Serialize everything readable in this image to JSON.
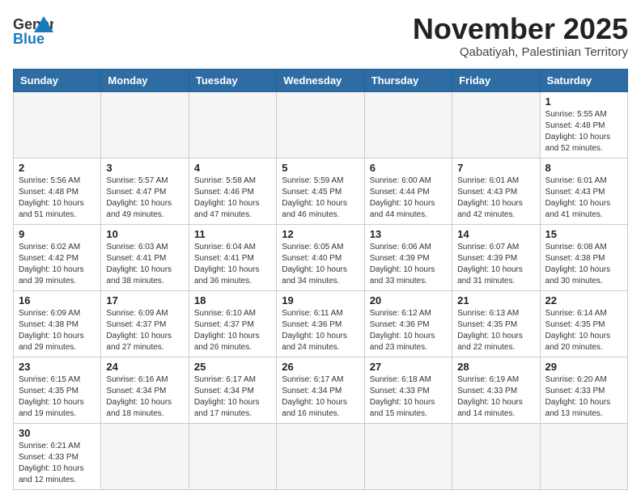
{
  "header": {
    "logo_general": "General",
    "logo_blue": "Blue",
    "title": "November 2025",
    "subtitle": "Qabatiyah, Palestinian Territory"
  },
  "weekdays": [
    "Sunday",
    "Monday",
    "Tuesday",
    "Wednesday",
    "Thursday",
    "Friday",
    "Saturday"
  ],
  "days": [
    {
      "date": "",
      "info": ""
    },
    {
      "date": "",
      "info": ""
    },
    {
      "date": "",
      "info": ""
    },
    {
      "date": "",
      "info": ""
    },
    {
      "date": "",
      "info": ""
    },
    {
      "date": "",
      "info": ""
    },
    {
      "date": "1",
      "info": "Sunrise: 5:55 AM\nSunset: 4:48 PM\nDaylight: 10 hours and 52 minutes."
    },
    {
      "date": "2",
      "info": "Sunrise: 5:56 AM\nSunset: 4:48 PM\nDaylight: 10 hours and 51 minutes."
    },
    {
      "date": "3",
      "info": "Sunrise: 5:57 AM\nSunset: 4:47 PM\nDaylight: 10 hours and 49 minutes."
    },
    {
      "date": "4",
      "info": "Sunrise: 5:58 AM\nSunset: 4:46 PM\nDaylight: 10 hours and 47 minutes."
    },
    {
      "date": "5",
      "info": "Sunrise: 5:59 AM\nSunset: 4:45 PM\nDaylight: 10 hours and 46 minutes."
    },
    {
      "date": "6",
      "info": "Sunrise: 6:00 AM\nSunset: 4:44 PM\nDaylight: 10 hours and 44 minutes."
    },
    {
      "date": "7",
      "info": "Sunrise: 6:01 AM\nSunset: 4:43 PM\nDaylight: 10 hours and 42 minutes."
    },
    {
      "date": "8",
      "info": "Sunrise: 6:01 AM\nSunset: 4:43 PM\nDaylight: 10 hours and 41 minutes."
    },
    {
      "date": "9",
      "info": "Sunrise: 6:02 AM\nSunset: 4:42 PM\nDaylight: 10 hours and 39 minutes."
    },
    {
      "date": "10",
      "info": "Sunrise: 6:03 AM\nSunset: 4:41 PM\nDaylight: 10 hours and 38 minutes."
    },
    {
      "date": "11",
      "info": "Sunrise: 6:04 AM\nSunset: 4:41 PM\nDaylight: 10 hours and 36 minutes."
    },
    {
      "date": "12",
      "info": "Sunrise: 6:05 AM\nSunset: 4:40 PM\nDaylight: 10 hours and 34 minutes."
    },
    {
      "date": "13",
      "info": "Sunrise: 6:06 AM\nSunset: 4:39 PM\nDaylight: 10 hours and 33 minutes."
    },
    {
      "date": "14",
      "info": "Sunrise: 6:07 AM\nSunset: 4:39 PM\nDaylight: 10 hours and 31 minutes."
    },
    {
      "date": "15",
      "info": "Sunrise: 6:08 AM\nSunset: 4:38 PM\nDaylight: 10 hours and 30 minutes."
    },
    {
      "date": "16",
      "info": "Sunrise: 6:09 AM\nSunset: 4:38 PM\nDaylight: 10 hours and 29 minutes."
    },
    {
      "date": "17",
      "info": "Sunrise: 6:09 AM\nSunset: 4:37 PM\nDaylight: 10 hours and 27 minutes."
    },
    {
      "date": "18",
      "info": "Sunrise: 6:10 AM\nSunset: 4:37 PM\nDaylight: 10 hours and 26 minutes."
    },
    {
      "date": "19",
      "info": "Sunrise: 6:11 AM\nSunset: 4:36 PM\nDaylight: 10 hours and 24 minutes."
    },
    {
      "date": "20",
      "info": "Sunrise: 6:12 AM\nSunset: 4:36 PM\nDaylight: 10 hours and 23 minutes."
    },
    {
      "date": "21",
      "info": "Sunrise: 6:13 AM\nSunset: 4:35 PM\nDaylight: 10 hours and 22 minutes."
    },
    {
      "date": "22",
      "info": "Sunrise: 6:14 AM\nSunset: 4:35 PM\nDaylight: 10 hours and 20 minutes."
    },
    {
      "date": "23",
      "info": "Sunrise: 6:15 AM\nSunset: 4:35 PM\nDaylight: 10 hours and 19 minutes."
    },
    {
      "date": "24",
      "info": "Sunrise: 6:16 AM\nSunset: 4:34 PM\nDaylight: 10 hours and 18 minutes."
    },
    {
      "date": "25",
      "info": "Sunrise: 6:17 AM\nSunset: 4:34 PM\nDaylight: 10 hours and 17 minutes."
    },
    {
      "date": "26",
      "info": "Sunrise: 6:17 AM\nSunset: 4:34 PM\nDaylight: 10 hours and 16 minutes."
    },
    {
      "date": "27",
      "info": "Sunrise: 6:18 AM\nSunset: 4:33 PM\nDaylight: 10 hours and 15 minutes."
    },
    {
      "date": "28",
      "info": "Sunrise: 6:19 AM\nSunset: 4:33 PM\nDaylight: 10 hours and 14 minutes."
    },
    {
      "date": "29",
      "info": "Sunrise: 6:20 AM\nSunset: 4:33 PM\nDaylight: 10 hours and 13 minutes."
    },
    {
      "date": "30",
      "info": "Sunrise: 6:21 AM\nSunset: 4:33 PM\nDaylight: 10 hours and 12 minutes."
    },
    {
      "date": "",
      "info": ""
    },
    {
      "date": "",
      "info": ""
    },
    {
      "date": "",
      "info": ""
    },
    {
      "date": "",
      "info": ""
    },
    {
      "date": "",
      "info": ""
    },
    {
      "date": "",
      "info": ""
    }
  ]
}
